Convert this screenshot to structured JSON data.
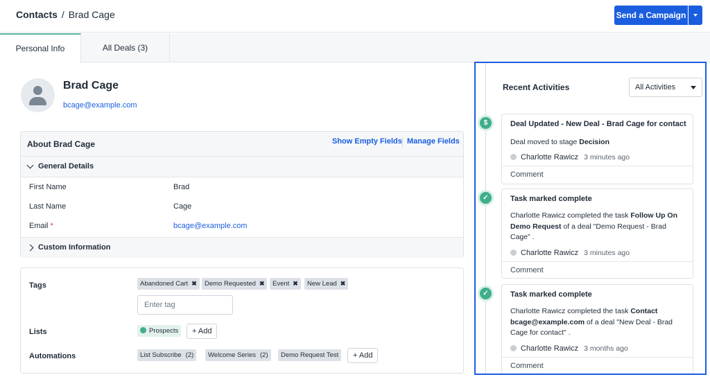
{
  "breadcrumb": {
    "root": "Contacts",
    "separator": "/",
    "current": "Brad Cage"
  },
  "header": {
    "campaign_button": "Send a Campaign"
  },
  "tabs": [
    {
      "label": "Personal Info",
      "active": true
    },
    {
      "label": "All Deals (3)",
      "active": false
    }
  ],
  "contact": {
    "name": "Brad Cage",
    "email": "bcage@example.com"
  },
  "about": {
    "title": "About Brad Cage",
    "show_empty_fields": "Show Empty Fields",
    "manage_fields": "Manage Fields",
    "general_details": "General Details",
    "fields": [
      {
        "label": "First Name",
        "value": "Brad"
      },
      {
        "label": "Last Name",
        "value": "Cage"
      },
      {
        "label": "Email",
        "value": "bcage@example.com",
        "required": "*"
      }
    ],
    "custom_information": "Custom Information"
  },
  "tags": {
    "label": "Tags",
    "items": [
      "Abandoned Cart",
      "Demo Requested",
      "Event",
      "New Lead"
    ],
    "remove_glyph": "✖",
    "input_placeholder": "Enter tag"
  },
  "lists": {
    "label": "Lists",
    "items": [
      "Prospects"
    ],
    "add_label": "+ Add"
  },
  "automations": {
    "label": "Automations",
    "items": [
      {
        "name": "List Subscribe",
        "count": "(2)"
      },
      {
        "name": "Welcome Series",
        "count": "(2)"
      },
      {
        "name": "Demo Request Test",
        "count": ""
      }
    ],
    "add_label": "+ Add"
  },
  "activities": {
    "title": "Recent Activities",
    "filter": "All Activities",
    "items": [
      {
        "icon": "dollar-icon",
        "glyph": "$",
        "title": "Deal Updated - New Deal - Brad Cage for contact",
        "text_prefix": "Deal moved to stage ",
        "text_bold": "Decision",
        "text_suffix": "",
        "user": "Charlotte Rawicz",
        "time": "3 minutes ago",
        "comment": "Comment"
      },
      {
        "icon": "check-icon",
        "glyph": "✓",
        "title": "Task marked complete",
        "text_prefix": "Charlotte Rawicz completed the task ",
        "text_bold": "Follow Up On Demo Request",
        "text_suffix": " of a deal \"Demo Request - Brad Cage\" .",
        "user": "Charlotte Rawicz",
        "time": "3 minutes ago",
        "comment": "Comment"
      },
      {
        "icon": "check-icon",
        "glyph": "✓",
        "title": "Task marked complete",
        "text_prefix": "Charlotte Rawicz completed the task ",
        "text_bold": "Contact bcage@example.com",
        "text_suffix": " of a deal \"New Deal - Brad Cage for contact\" .",
        "user": "Charlotte Rawicz",
        "time": "3 months ago",
        "comment": "Comment"
      }
    ]
  },
  "colors": {
    "accent": "#1a5ddf",
    "success": "#3fae8c",
    "tab_indicator": "#55b3a0"
  }
}
